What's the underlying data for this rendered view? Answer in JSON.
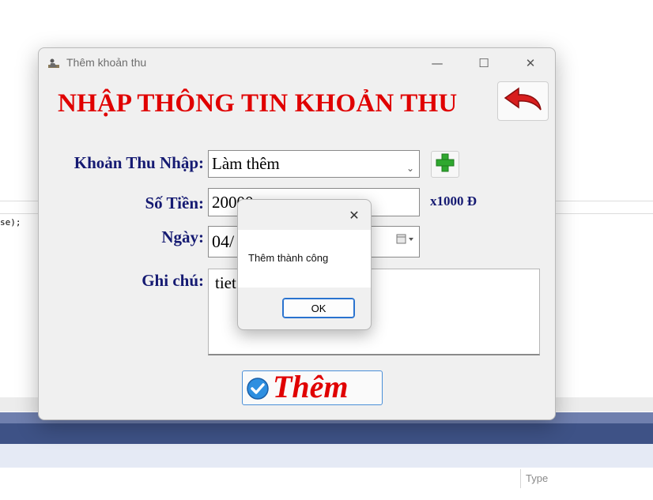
{
  "background": {
    "code_fragment": "se);",
    "type_field_placeholder": "Type"
  },
  "window": {
    "title": "Thêm khoản thu",
    "minimize_glyph": "—",
    "maximize_glyph": "☐",
    "close_glyph": "✕"
  },
  "form": {
    "heading": "NHẬP THÔNG TIN KHOẢN THU",
    "category_label": "Khoản Thu Nhập:",
    "category_value": "Làm thêm",
    "amount_label": "Số Tiền:",
    "amount_value": "20000",
    "amount_unit": "x1000 Đ",
    "date_label": "Ngày:",
    "date_value": "04/",
    "note_label": "Ghi chú:",
    "note_value": "tiet",
    "add_button_label": "Thêm"
  },
  "dialog": {
    "message": "Thêm thành công",
    "ok_label": "OK",
    "close_glyph": "✕"
  },
  "colors": {
    "heading_red": "#e00000",
    "label_navy": "#151a72",
    "accent_blue": "#2a73cf"
  },
  "icons": [
    "app-icon",
    "back-arrow-icon",
    "plus-icon",
    "calendar-icon",
    "check-circle-icon",
    "close-icon"
  ]
}
